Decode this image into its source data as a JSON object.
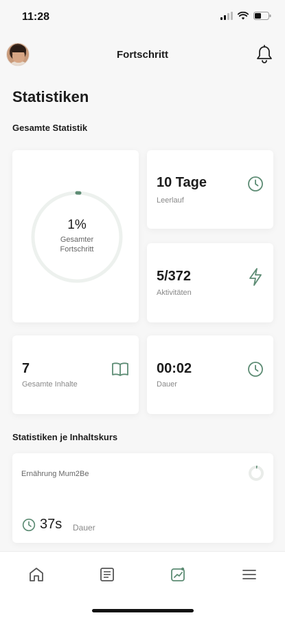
{
  "status_bar": {
    "time": "11:28"
  },
  "header": {
    "title": "Fortschritt"
  },
  "page": {
    "title": "Statistiken"
  },
  "overall": {
    "section_title": "Gesamte Statistik",
    "progress_percent": "1%",
    "progress_fraction": 0.01,
    "progress_caption_line1": "Gesamter",
    "progress_caption_line2": "Fortschritt",
    "idle_value": "10 Tage",
    "idle_label": "Leerlauf",
    "activities_value": "5/372",
    "activities_label": "Aktivitäten",
    "content_value": "7",
    "content_label": "Gesamte Inhalte",
    "duration_value": "00:02",
    "duration_label": "Dauer"
  },
  "per_course": {
    "section_title": "Statistiken je Inhaltskurs",
    "courses": [
      {
        "name": "Ernährung Mum2Be",
        "duration_value": "37s",
        "duration_label": "Dauer"
      }
    ]
  },
  "tabbar": {
    "items": [
      {
        "icon": "home-icon"
      },
      {
        "icon": "content-icon"
      },
      {
        "icon": "progress-icon"
      },
      {
        "icon": "menu-icon"
      }
    ]
  },
  "colors": {
    "accent": "#5d8c74",
    "ring_track": "#edf1ee"
  }
}
